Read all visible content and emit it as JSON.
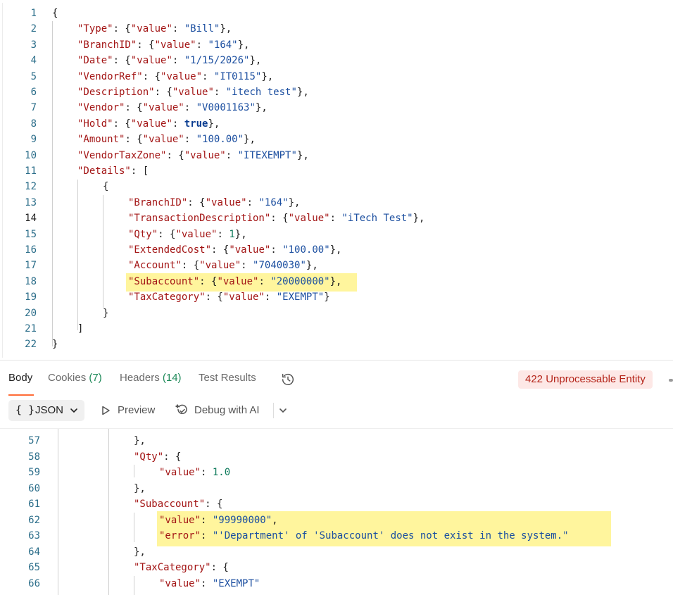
{
  "request_editor": {
    "lines": [
      {
        "num": "1",
        "tokens": [
          {
            "t": "p",
            "v": "{"
          }
        ]
      },
      {
        "num": "2",
        "tokens": [
          {
            "t": "k",
            "v": "\"Type\""
          },
          {
            "t": "p",
            "v": ": {"
          },
          {
            "t": "k",
            "v": "\"value\""
          },
          {
            "t": "p",
            "v": ": "
          },
          {
            "t": "s",
            "v": "\"Bill\""
          },
          {
            "t": "p",
            "v": "},"
          }
        ]
      },
      {
        "num": "3",
        "tokens": [
          {
            "t": "k",
            "v": "\"BranchID\""
          },
          {
            "t": "p",
            "v": ": {"
          },
          {
            "t": "k",
            "v": "\"value\""
          },
          {
            "t": "p",
            "v": ": "
          },
          {
            "t": "s",
            "v": "\"164\""
          },
          {
            "t": "p",
            "v": "},"
          }
        ]
      },
      {
        "num": "4",
        "tokens": [
          {
            "t": "k",
            "v": "\"Date\""
          },
          {
            "t": "p",
            "v": ": {"
          },
          {
            "t": "k",
            "v": "\"value\""
          },
          {
            "t": "p",
            "v": ": "
          },
          {
            "t": "s",
            "v": "\"1/15/2026\""
          },
          {
            "t": "p",
            "v": "},"
          }
        ]
      },
      {
        "num": "5",
        "tokens": [
          {
            "t": "k",
            "v": "\"VendorRef\""
          },
          {
            "t": "p",
            "v": ": {"
          },
          {
            "t": "k",
            "v": "\"value\""
          },
          {
            "t": "p",
            "v": ": "
          },
          {
            "t": "s",
            "v": "\"IT0115\""
          },
          {
            "t": "p",
            "v": "},"
          }
        ]
      },
      {
        "num": "6",
        "tokens": [
          {
            "t": "k",
            "v": "\"Description\""
          },
          {
            "t": "p",
            "v": ": {"
          },
          {
            "t": "k",
            "v": "\"value\""
          },
          {
            "t": "p",
            "v": ": "
          },
          {
            "t": "s",
            "v": "\"itech test\""
          },
          {
            "t": "p",
            "v": "},"
          }
        ]
      },
      {
        "num": "7",
        "tokens": [
          {
            "t": "k",
            "v": "\"Vendor\""
          },
          {
            "t": "p",
            "v": ": {"
          },
          {
            "t": "k",
            "v": "\"value\""
          },
          {
            "t": "p",
            "v": ": "
          },
          {
            "t": "s",
            "v": "\"V0001163\""
          },
          {
            "t": "p",
            "v": "},"
          }
        ]
      },
      {
        "num": "8",
        "tokens": [
          {
            "t": "k",
            "v": "\"Hold\""
          },
          {
            "t": "p",
            "v": ": {"
          },
          {
            "t": "k",
            "v": "\"value\""
          },
          {
            "t": "p",
            "v": ": "
          },
          {
            "t": "b",
            "v": "true"
          },
          {
            "t": "p",
            "v": "},"
          }
        ]
      },
      {
        "num": "9",
        "tokens": [
          {
            "t": "k",
            "v": "\"Amount\""
          },
          {
            "t": "p",
            "v": ": {"
          },
          {
            "t": "k",
            "v": "\"value\""
          },
          {
            "t": "p",
            "v": ": "
          },
          {
            "t": "s",
            "v": "\"100.00\""
          },
          {
            "t": "p",
            "v": "},"
          }
        ]
      },
      {
        "num": "10",
        "tokens": [
          {
            "t": "k",
            "v": "\"VendorTaxZone\""
          },
          {
            "t": "p",
            "v": ": {"
          },
          {
            "t": "k",
            "v": "\"value\""
          },
          {
            "t": "p",
            "v": ": "
          },
          {
            "t": "s",
            "v": "\"ITEXEMPT\""
          },
          {
            "t": "p",
            "v": "},"
          }
        ]
      },
      {
        "num": "11",
        "tokens": [
          {
            "t": "k",
            "v": "\"Details\""
          },
          {
            "t": "p",
            "v": ": ["
          }
        ]
      },
      {
        "num": "12",
        "tokens": [
          {
            "t": "p",
            "v": "{"
          }
        ]
      },
      {
        "num": "13",
        "tokens": [
          {
            "t": "k",
            "v": "\"BranchID\""
          },
          {
            "t": "p",
            "v": ": {"
          },
          {
            "t": "k",
            "v": "\"value\""
          },
          {
            "t": "p",
            "v": ": "
          },
          {
            "t": "s",
            "v": "\"164\""
          },
          {
            "t": "p",
            "v": "},"
          }
        ]
      },
      {
        "num": "14",
        "tokens": [
          {
            "t": "k",
            "v": "\"TransactionDescription\""
          },
          {
            "t": "p",
            "v": ": {"
          },
          {
            "t": "k",
            "v": "\"value\""
          },
          {
            "t": "p",
            "v": ": "
          },
          {
            "t": "s",
            "v": "\"iTech Test\""
          },
          {
            "t": "p",
            "v": "},"
          }
        ]
      },
      {
        "num": "15",
        "tokens": [
          {
            "t": "k",
            "v": "\"Qty\""
          },
          {
            "t": "p",
            "v": ": {"
          },
          {
            "t": "k",
            "v": "\"value\""
          },
          {
            "t": "p",
            "v": ": "
          },
          {
            "t": "n",
            "v": "1"
          },
          {
            "t": "p",
            "v": "},"
          }
        ]
      },
      {
        "num": "16",
        "tokens": [
          {
            "t": "k",
            "v": "\"ExtendedCost\""
          },
          {
            "t": "p",
            "v": ": {"
          },
          {
            "t": "k",
            "v": "\"value\""
          },
          {
            "t": "p",
            "v": ": "
          },
          {
            "t": "s",
            "v": "\"100.00\""
          },
          {
            "t": "p",
            "v": "},"
          }
        ]
      },
      {
        "num": "17",
        "tokens": [
          {
            "t": "k",
            "v": "\"Account\""
          },
          {
            "t": "p",
            "v": ": {"
          },
          {
            "t": "k",
            "v": "\"value\""
          },
          {
            "t": "p",
            "v": ": "
          },
          {
            "t": "s",
            "v": "\"7040030\""
          },
          {
            "t": "p",
            "v": "},"
          }
        ]
      },
      {
        "num": "18",
        "tokens": [
          {
            "t": "k",
            "v": "\"Subaccount\""
          },
          {
            "t": "p",
            "v": ": {"
          },
          {
            "t": "k",
            "v": "\"value\""
          },
          {
            "t": "p",
            "v": ": "
          },
          {
            "t": "s",
            "v": "\"20000000\""
          },
          {
            "t": "p",
            "v": "},"
          }
        ]
      },
      {
        "num": "19",
        "tokens": [
          {
            "t": "k",
            "v": "\"TaxCategory\""
          },
          {
            "t": "p",
            "v": ": {"
          },
          {
            "t": "k",
            "v": "\"value\""
          },
          {
            "t": "p",
            "v": ": "
          },
          {
            "t": "s",
            "v": "\"EXEMPT\""
          },
          {
            "t": "p",
            "v": "}"
          }
        ]
      },
      {
        "num": "20",
        "tokens": [
          {
            "t": "p",
            "v": "}"
          }
        ]
      },
      {
        "num": "21",
        "tokens": [
          {
            "t": "p",
            "v": "]"
          }
        ]
      },
      {
        "num": "22",
        "tokens": [
          {
            "t": "p",
            "v": "}"
          }
        ]
      }
    ]
  },
  "response_tabs": {
    "body": "Body",
    "cookies": "Cookies",
    "cookies_count": "(7)",
    "headers": "Headers",
    "headers_count": "(14)",
    "test_results": "Test Results",
    "history_icon": "history-icon",
    "status": "422 Unprocessable Entity",
    "status_color": "#b42318"
  },
  "response_toolbar": {
    "format_brace": "{ }",
    "format": "JSON",
    "preview": "Preview",
    "debug": "Debug with AI"
  },
  "response_body": {
    "lines": [
      {
        "num": "57",
        "tokens": [
          {
            "t": "p",
            "v": "},"
          }
        ]
      },
      {
        "num": "58",
        "tokens": [
          {
            "t": "k",
            "v": "\"Qty\""
          },
          {
            "t": "p",
            "v": ": {"
          }
        ]
      },
      {
        "num": "59",
        "tokens": [
          {
            "t": "k",
            "v": "\"value\""
          },
          {
            "t": "p",
            "v": ": "
          },
          {
            "t": "n",
            "v": "1.0"
          }
        ]
      },
      {
        "num": "60",
        "tokens": [
          {
            "t": "p",
            "v": "},"
          }
        ]
      },
      {
        "num": "61",
        "tokens": [
          {
            "t": "k",
            "v": "\"Subaccount\""
          },
          {
            "t": "p",
            "v": ": {"
          }
        ]
      },
      {
        "num": "62",
        "tokens": [
          {
            "t": "k",
            "v": "\"value\""
          },
          {
            "t": "p",
            "v": ": "
          },
          {
            "t": "s",
            "v": "\"99990000\""
          },
          {
            "t": "p",
            "v": ","
          }
        ]
      },
      {
        "num": "63",
        "tokens": [
          {
            "t": "k",
            "v": "\"error\""
          },
          {
            "t": "p",
            "v": ": "
          },
          {
            "t": "s",
            "v": "\"'Department' of 'Subaccount' does not exist in the system.\""
          }
        ]
      },
      {
        "num": "64",
        "tokens": [
          {
            "t": "p",
            "v": "},"
          }
        ]
      },
      {
        "num": "65",
        "tokens": [
          {
            "t": "k",
            "v": "\"TaxCategory\""
          },
          {
            "t": "p",
            "v": ": {"
          }
        ]
      },
      {
        "num": "66",
        "tokens": [
          {
            "t": "k",
            "v": "\"value\""
          },
          {
            "t": "p",
            "v": ": "
          },
          {
            "t": "s",
            "v": "\"EXEMPT\""
          }
        ]
      }
    ]
  },
  "colors": {
    "accent": "#ff6c37",
    "highlight": "#fff59d",
    "key": "#a31515",
    "string": "#1c4fa0",
    "number": "#0f7b5c",
    "count": "#1f8a5a"
  }
}
